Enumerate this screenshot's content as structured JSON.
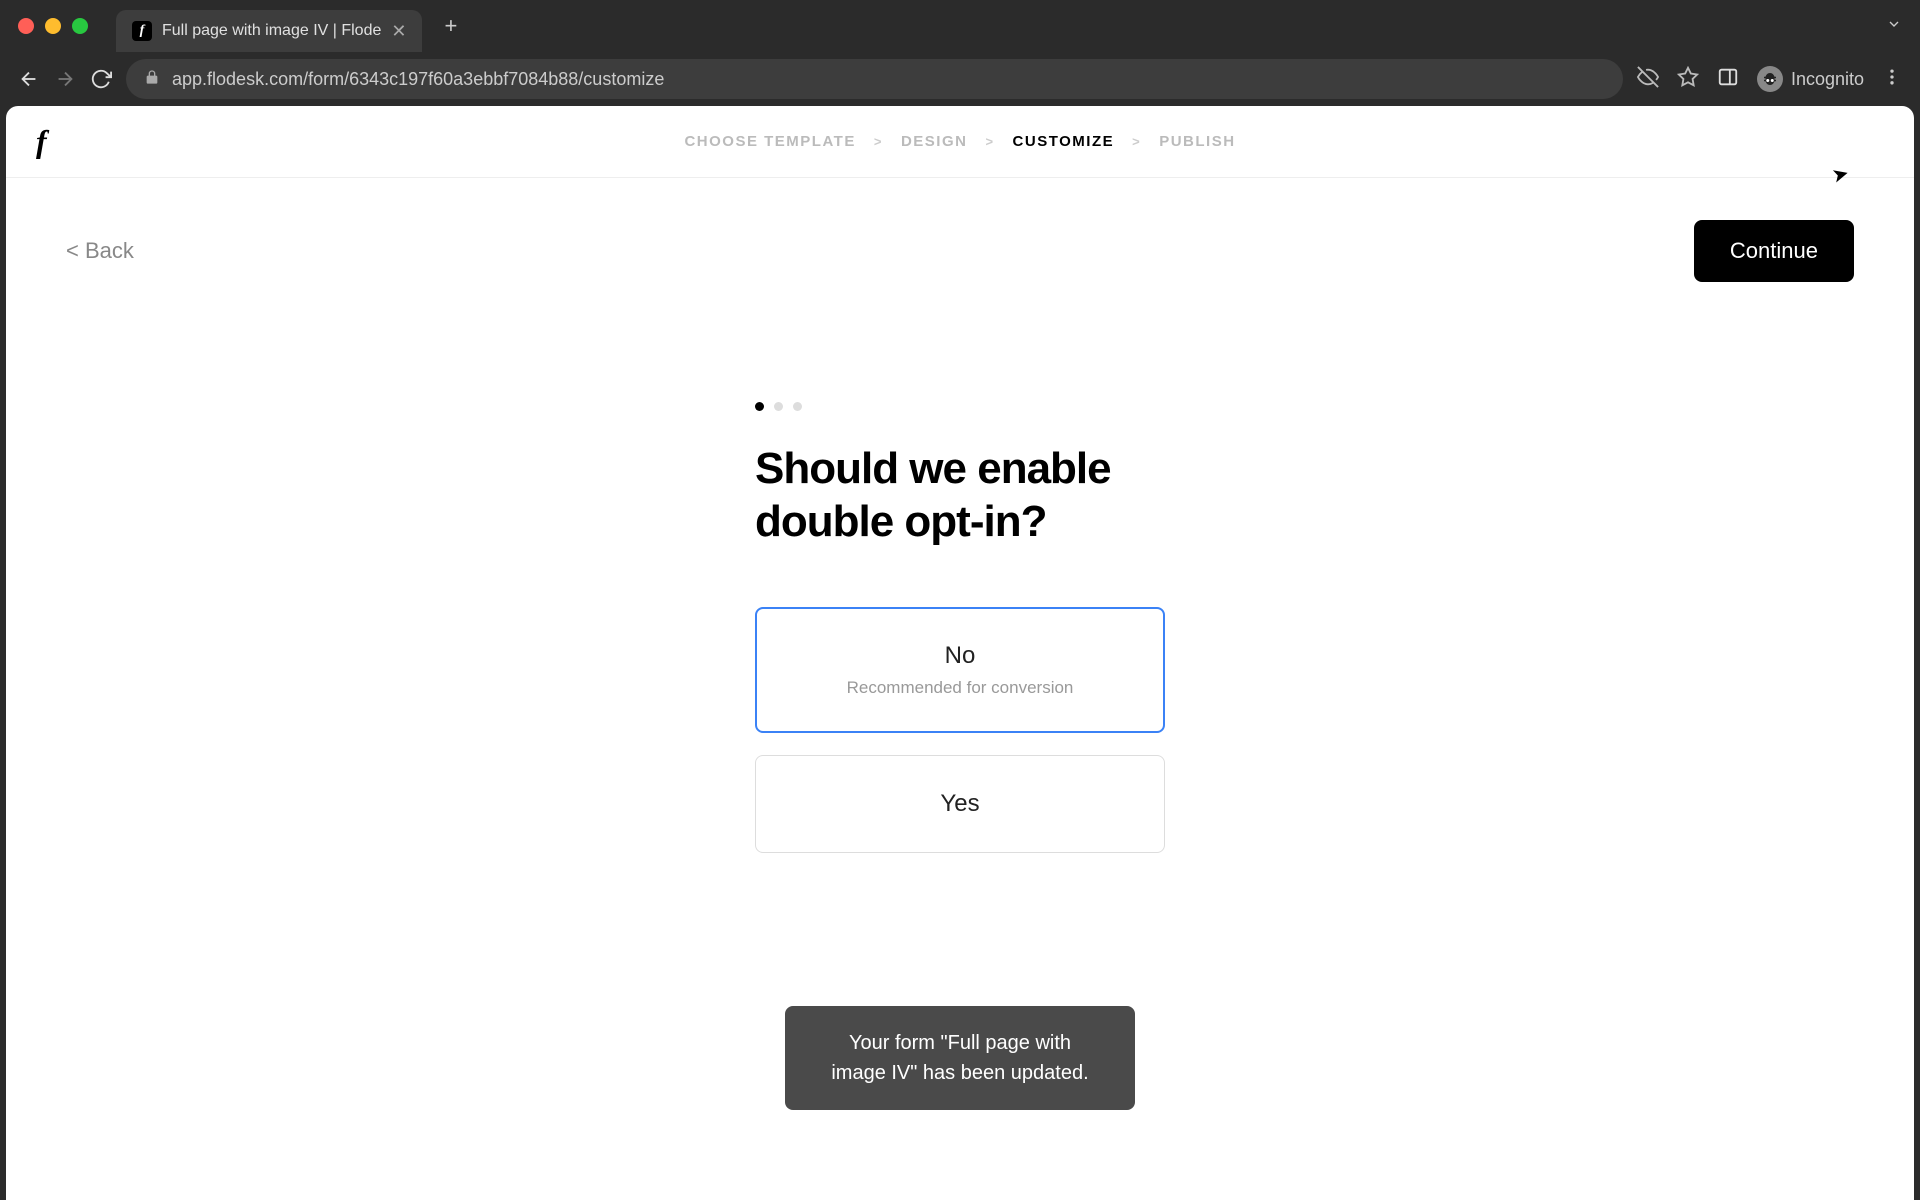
{
  "browser": {
    "tab_title": "Full page with image IV | Flode",
    "url": "app.flodesk.com/form/6343c197f60a3ebbf7084b88/customize",
    "profile": "Incognito"
  },
  "header": {
    "logo": "f",
    "breadcrumb": {
      "items": [
        {
          "label": "CHOOSE TEMPLATE",
          "active": false
        },
        {
          "label": "DESIGN",
          "active": false
        },
        {
          "label": "CUSTOMIZE",
          "active": true
        },
        {
          "label": "PUBLISH",
          "active": false
        }
      ],
      "separator": ">"
    }
  },
  "actions": {
    "back": "< Back",
    "continue": "Continue"
  },
  "wizard": {
    "step": 1,
    "total_steps": 3,
    "question": "Should we enable double opt-in?",
    "options": [
      {
        "label": "No",
        "sublabel": "Recommended for conversion",
        "selected": true
      },
      {
        "label": "Yes",
        "sublabel": "",
        "selected": false
      }
    ]
  },
  "toast": {
    "message": "Your form \"Full page with image IV\" has been updated."
  }
}
